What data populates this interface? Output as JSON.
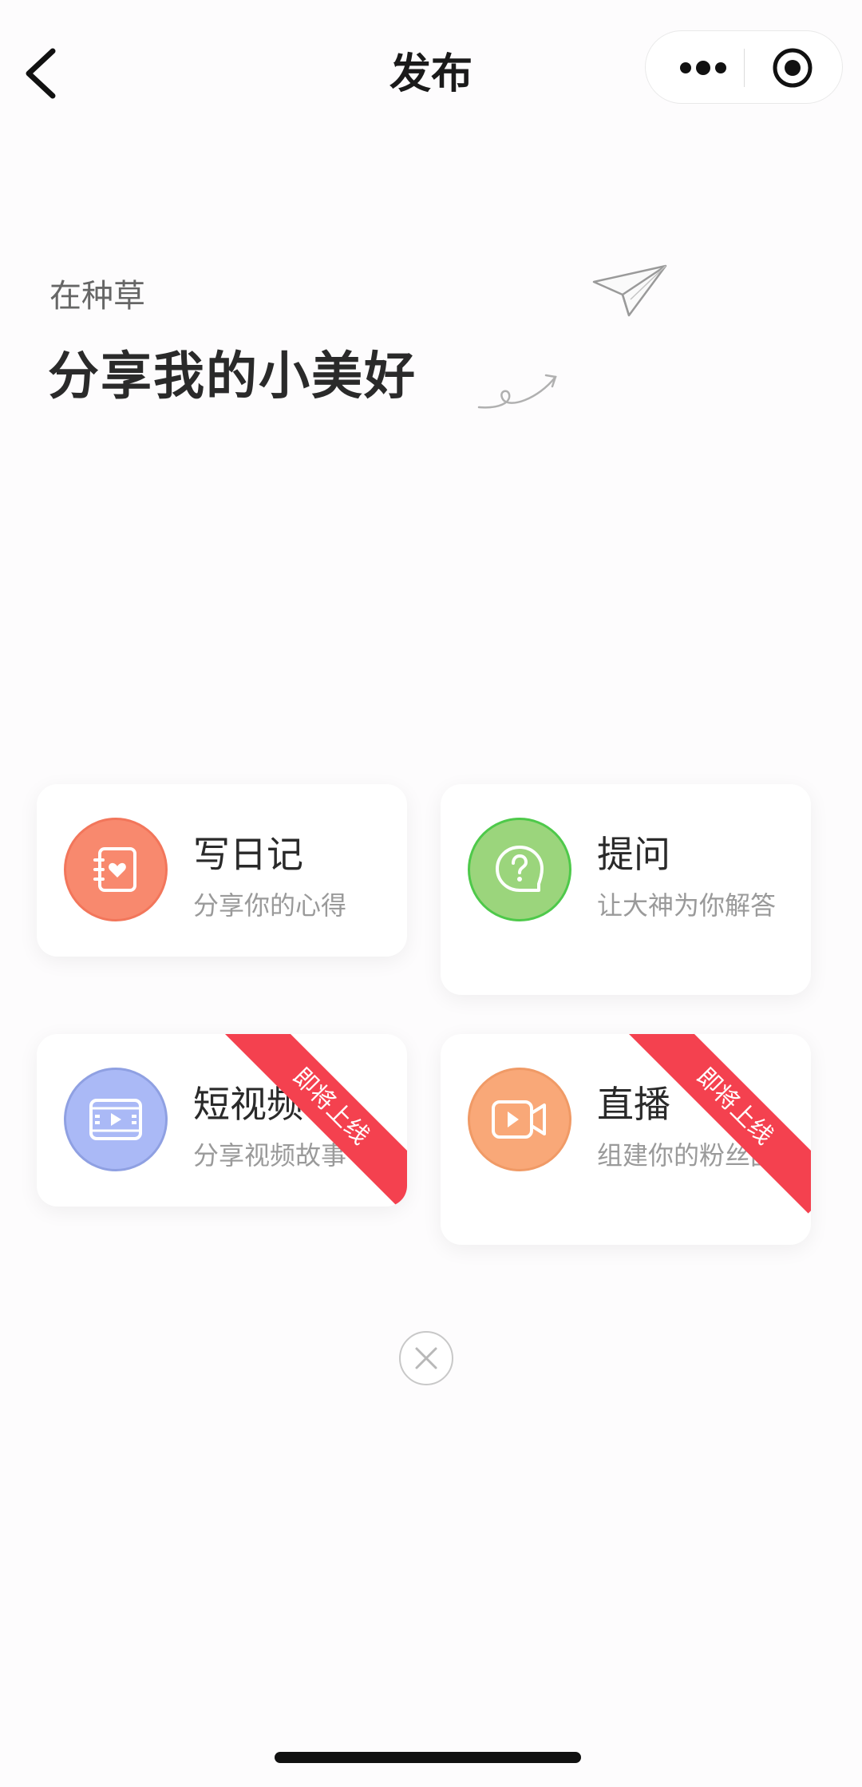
{
  "navbar": {
    "title": "发布",
    "back_icon": "chevron-left-icon",
    "more_icon": "more-dots-icon",
    "target_icon": "target-icon"
  },
  "hero": {
    "subtitle": "在种草",
    "headline": "分享我的小美好",
    "decoration_icon": "paper-plane-icon"
  },
  "options": [
    {
      "title": "写日记",
      "desc": "分享你的心得",
      "icon": "diary-heart-icon",
      "color": "#f8896e",
      "border": "#f2765b",
      "badge": ""
    },
    {
      "title": "提问",
      "desc": "让大神为你解答",
      "icon": "question-bubble-icon",
      "color": "#9bd57c",
      "border": "#4ec94a",
      "badge": ""
    },
    {
      "title": "短视频",
      "desc": "分享视频故事",
      "icon": "video-film-icon",
      "color": "#aab9f6",
      "border": "#8fa0e2",
      "badge": "即将上线"
    },
    {
      "title": "直播",
      "desc": "组建你的粉丝团",
      "icon": "live-camera-icon",
      "color": "#f9a878",
      "border": "#f09a66",
      "badge": "即将上线"
    }
  ],
  "close_icon": "close-circle-icon",
  "colors": {
    "ribbon": "#f4414f",
    "background": "#fdfcfd"
  }
}
